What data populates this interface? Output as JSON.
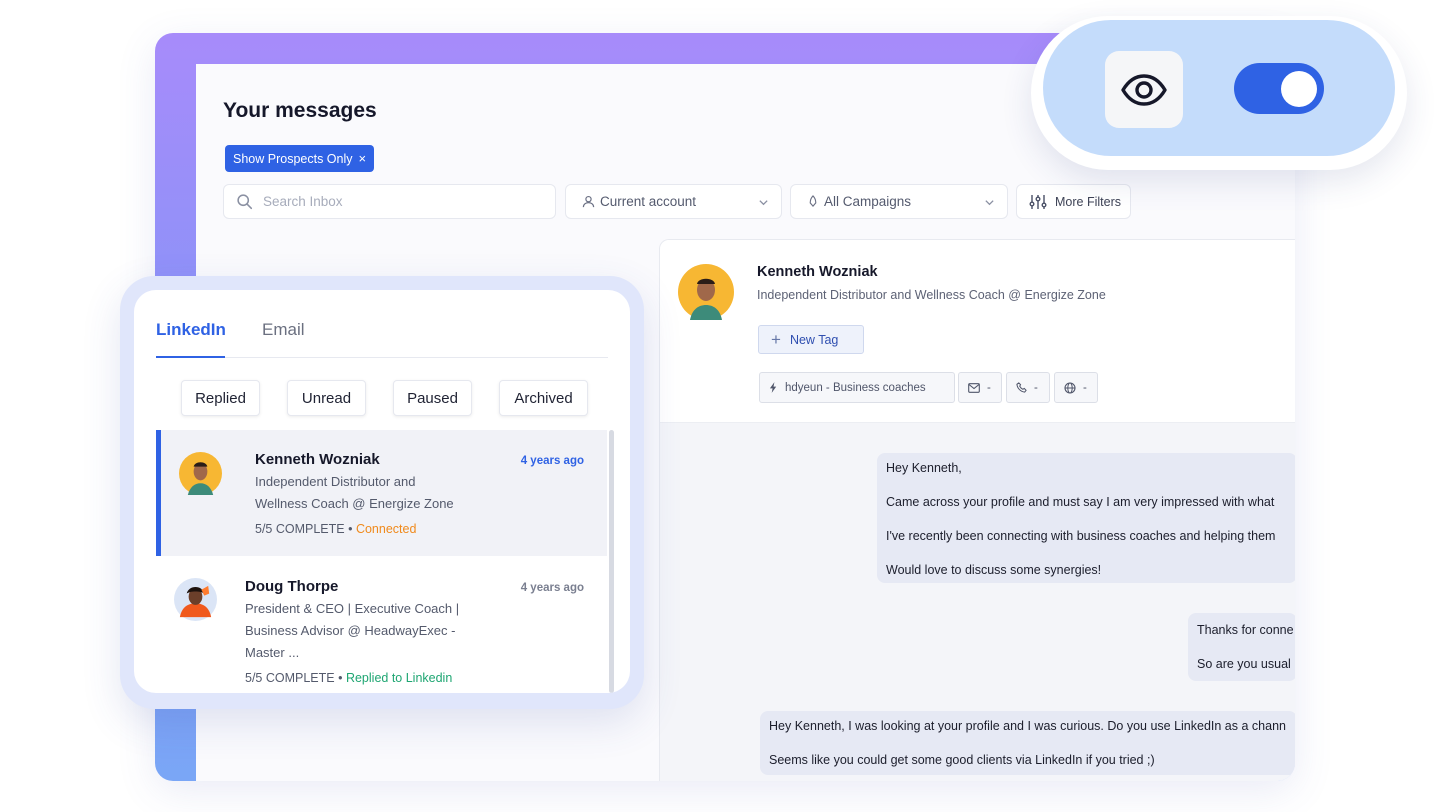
{
  "header": {
    "title": "Your messages",
    "chip_label": "Show Prospects Only",
    "chip_close": "×"
  },
  "filters": {
    "search_placeholder": "Search Inbox",
    "account": "Current account",
    "campaigns": "All Campaigns",
    "more": "More Filters"
  },
  "toggle": {
    "icon": "eye-icon",
    "state": "on",
    "accent": "#2f62e4"
  },
  "inbox": {
    "tabs": [
      {
        "label": "LinkedIn",
        "active": true
      },
      {
        "label": "Email",
        "active": false
      }
    ],
    "segments": [
      "Replied",
      "Unread",
      "Paused",
      "Archived"
    ],
    "conversations": [
      {
        "name": "Kenneth Wozniak",
        "time": "4 years ago",
        "desc_line1": "Independent Distributor and",
        "desc_line2": "Wellness Coach @ Energize Zone",
        "progress": "5/5 COMPLETE",
        "separator": " • ",
        "status": "Connected",
        "status_color": "#f08a1c"
      },
      {
        "name": "Doug Thorpe",
        "time": "4 years ago",
        "desc_line1": "President & CEO | Executive Coach |",
        "desc_line2": "Business Advisor @ HeadwayExec -",
        "desc_line3": "Master ...",
        "progress": "5/5 COMPLETE",
        "separator": " • ",
        "status": "Replied to Linkedin",
        "status_color": "#1ea672"
      }
    ]
  },
  "profile": {
    "name": "Kenneth Wozniak",
    "title": "Independent Distributor and Wellness Coach @ Energize Zone",
    "new_tag": "New Tag",
    "campaign_pill": "hdyeun  -  Business  coaches",
    "email_pill": "-",
    "phone_pill": "-",
    "web_pill": "-"
  },
  "messages": [
    {
      "lines": [
        "Hey Kenneth,",
        "Came across your profile and must say I am very impressed with what",
        "I've recently been connecting with business coaches and helping them",
        "Would love to discuss some synergies!"
      ]
    },
    {
      "lines": [
        "Thanks for conne",
        "So are you usual"
      ]
    },
    {
      "lines": [
        "Hey Kenneth, I was looking at your profile and I was curious. Do you use LinkedIn as a chann",
        "Seems like you could get some good clients via LinkedIn if you tried ;)"
      ]
    }
  ]
}
